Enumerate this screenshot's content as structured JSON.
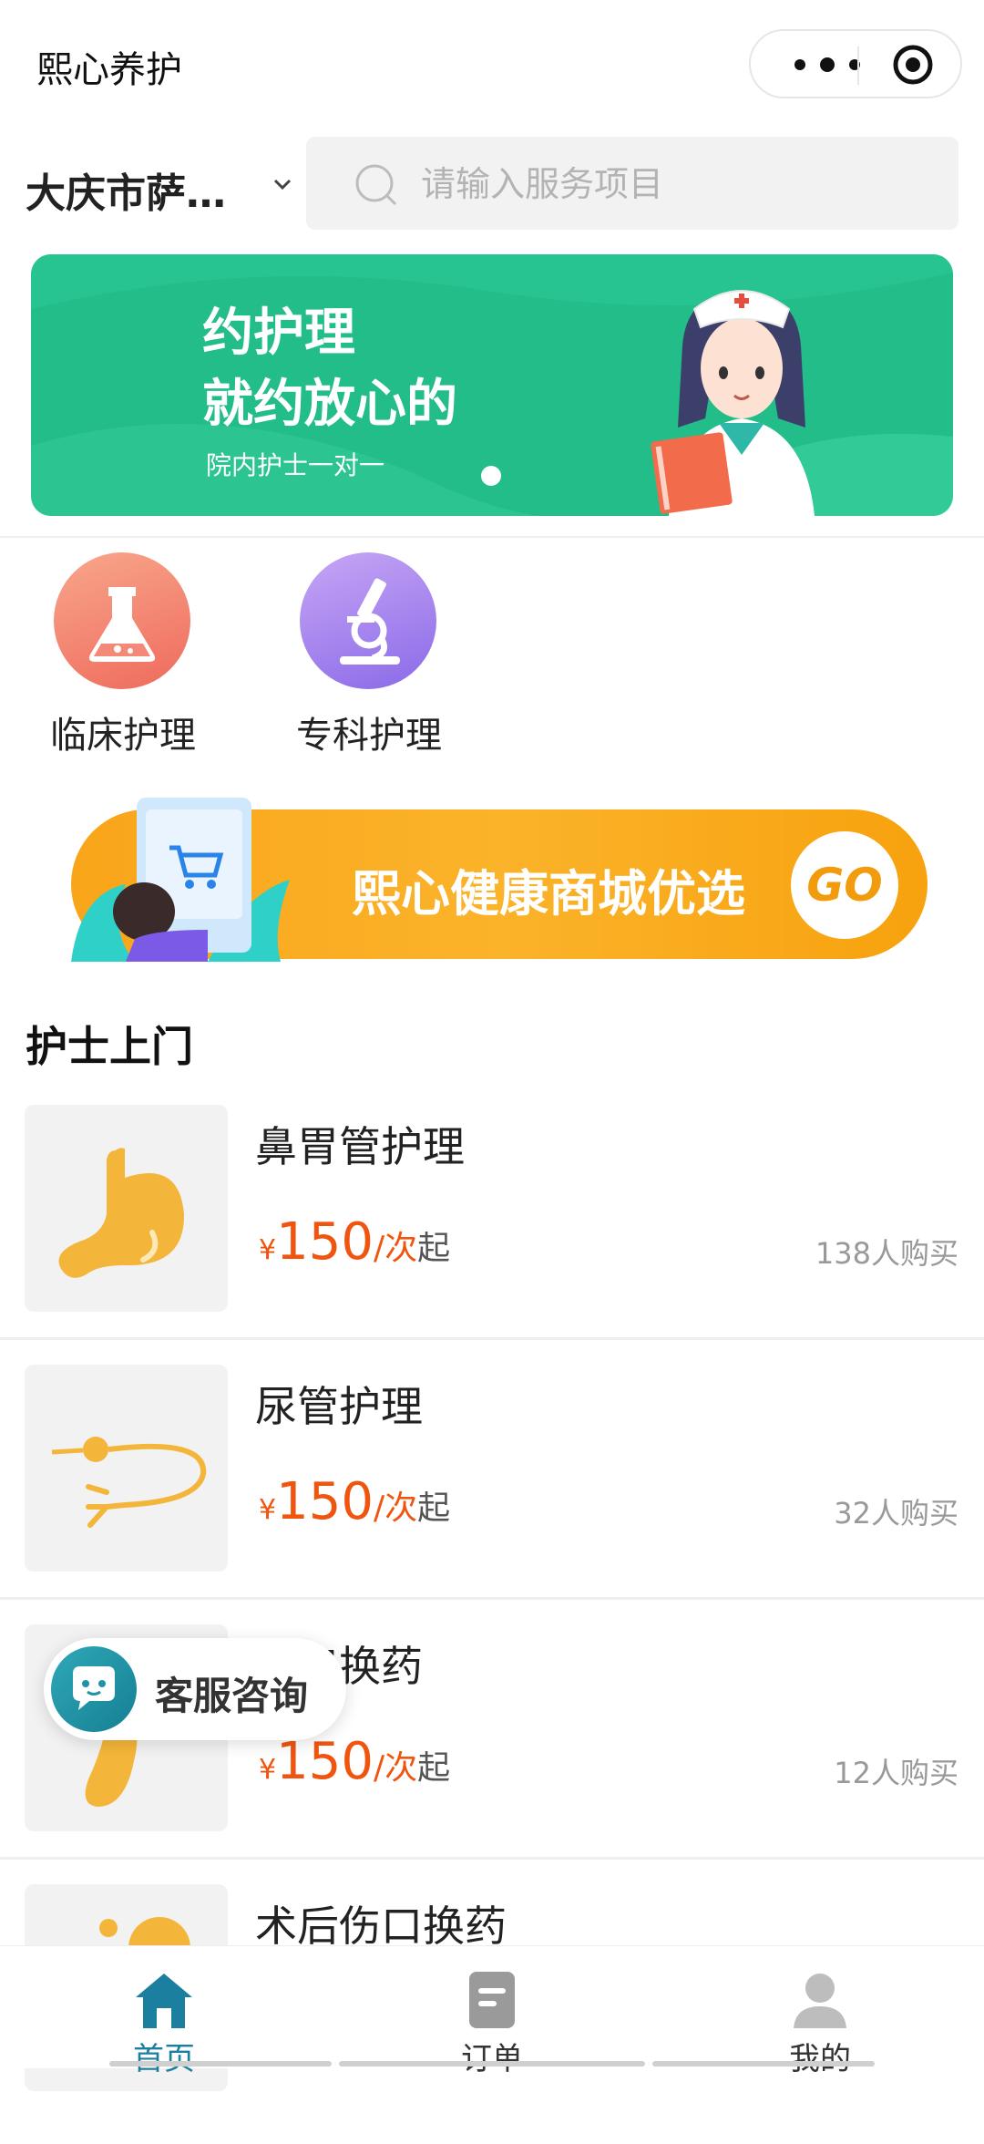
{
  "header": {
    "title": "熙心养护",
    "more_icon": "more-dots-icon",
    "target_icon": "target-icon"
  },
  "location": {
    "city": "大庆市萨…",
    "chevron_icon": "chevron-down-icon"
  },
  "search": {
    "placeholder": "请输入服务项目",
    "value": ""
  },
  "banner": {
    "title_line1": "约护理",
    "title_line2": "就约放心的",
    "subtitle": "院内护士一对一",
    "bg_color": "#22bd88"
  },
  "categories": [
    {
      "label": "临床护理",
      "icon": "flask-icon",
      "color_from": "#f8a78c",
      "color_to": "#ef6a5c"
    },
    {
      "label": "专科护理",
      "icon": "microscope-icon",
      "color_from": "#c7a6f5",
      "color_to": "#8a6ae8"
    }
  ],
  "promo": {
    "text": "熙心健康商城优选",
    "go": "GO",
    "color": "#f9a51a"
  },
  "section": {
    "title": "护士上门"
  },
  "services": [
    {
      "name": "鼻胃管护理",
      "yen": "¥",
      "price": "150",
      "per": "/次",
      "from": "起",
      "sales": "138人购买"
    },
    {
      "name": "尿管护理",
      "yen": "¥",
      "price": "150",
      "per": "/次",
      "from": "起",
      "sales": "32人购买"
    },
    {
      "name": "造口换药",
      "yen": "¥",
      "price": "150",
      "per": "/次",
      "from": "起",
      "sales": "12人购买"
    },
    {
      "name": "术后伤口换药"
    }
  ],
  "customer_service": {
    "label": "客服咨询"
  },
  "tabs": [
    {
      "label": "首页",
      "icon": "home-icon",
      "active": true
    },
    {
      "label": "订单",
      "icon": "order-icon",
      "active": false
    },
    {
      "label": "我的",
      "icon": "user-icon",
      "active": false
    }
  ],
  "colors": {
    "accent": "#f0550f",
    "tab_active": "#1b7fa0",
    "green": "#22bd88"
  }
}
